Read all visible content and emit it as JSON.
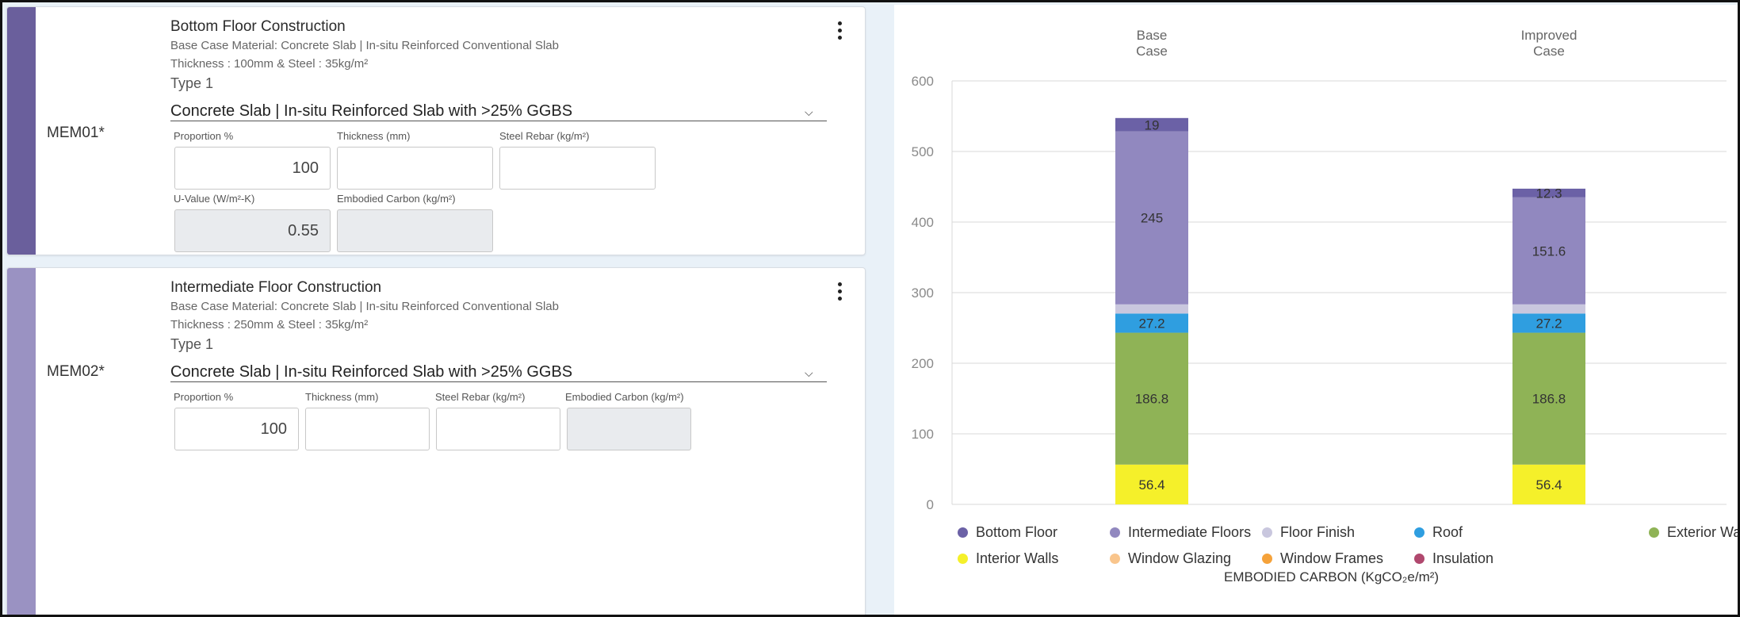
{
  "members": [
    {
      "code": "MEM01*",
      "title": "Bottom Floor Construction",
      "base_case": "Base Case Material: Concrete Slab | In-situ Reinforced Conventional Slab",
      "thickness": "Thickness : 100mm & Steel : 35kg/m²",
      "type": "Type 1",
      "selected_material": "Concrete Slab | In-situ Reinforced Slab with >25% GGBS",
      "labels": {
        "proportion": "Proportion %",
        "thickness": "Thickness (mm)",
        "steel": "Steel Rebar (kg/m²)",
        "u_value": "U-Value (W/m²-K)",
        "embodied": "Embodied Carbon (kg/m²)"
      },
      "values": {
        "proportion": "100",
        "thickness": "",
        "steel": "",
        "u_value": "0.55",
        "embodied": ""
      },
      "stripe_color": "#6a5f9c"
    },
    {
      "code": "MEM02*",
      "title": "Intermediate Floor Construction",
      "base_case": "Base Case Material: Concrete Slab | In-situ Reinforced Conventional Slab",
      "thickness": "Thickness : 250mm & Steel : 35kg/m²",
      "type": "Type 1",
      "selected_material": "Concrete Slab | In-situ Reinforced Slab with >25% GGBS",
      "labels": {
        "proportion": "Proportion %",
        "thickness": "Thickness (mm)",
        "steel": "Steel Rebar (kg/m²)",
        "embodied": "Embodied Carbon (kg/m²)"
      },
      "values": {
        "proportion": "100",
        "thickness": "",
        "steel": "",
        "embodied": ""
      },
      "stripe_color": "#9a92c2"
    }
  ],
  "chart_data": {
    "type": "bar",
    "stacked": true,
    "categories": [
      "Base\nCase",
      "Improved\nCase"
    ],
    "ylim": [
      0,
      600
    ],
    "yticks": [
      0,
      100,
      200,
      300,
      400,
      500,
      600
    ],
    "xlabel": "EMBODIED CARBON (KgCO₂e/m²)",
    "grid": true,
    "legend_position": "bottom",
    "series": [
      {
        "name": "Interior Walls",
        "color": "#f5f02a",
        "values": [
          56.4,
          56.4
        ],
        "labels": [
          "56.4",
          "56.4"
        ]
      },
      {
        "name": "Exterior Walls",
        "color": "#8fb356",
        "values": [
          186.8,
          186.8
        ],
        "labels": [
          "186.8",
          "186.8"
        ]
      },
      {
        "name": "Roof",
        "color": "#2f9ee0",
        "values": [
          27.2,
          27.2
        ],
        "labels": [
          "27.2",
          "27.2"
        ]
      },
      {
        "name": "Floor Finish",
        "color": "#c9c7de",
        "values": [
          13,
          13
        ],
        "labels": [
          "",
          ""
        ]
      },
      {
        "name": "Intermediate Floors",
        "color": "#9188bf",
        "values": [
          245,
          151.6
        ],
        "labels": [
          "245",
          "151.6"
        ]
      },
      {
        "name": "Bottom Floor",
        "color": "#6b61a6",
        "values": [
          19,
          12.3
        ],
        "labels": [
          "19",
          "12.3"
        ]
      },
      {
        "name": "Window Glazing",
        "color": "#f9c58c",
        "values": [
          0,
          0
        ],
        "labels": [
          "",
          ""
        ]
      },
      {
        "name": "Window Frames",
        "color": "#f5a23a",
        "values": [
          0,
          0
        ],
        "labels": [
          "",
          ""
        ]
      },
      {
        "name": "Insulation",
        "color": "#b0486e",
        "values": [
          0,
          0
        ],
        "labels": [
          "",
          ""
        ]
      }
    ],
    "legend_order": [
      "Bottom Floor",
      "Intermediate Floors",
      "Floor Finish",
      "Roof",
      "Exterior Walls",
      "Interior Walls",
      "Window Glazing",
      "Window Frames",
      "Insulation"
    ]
  }
}
